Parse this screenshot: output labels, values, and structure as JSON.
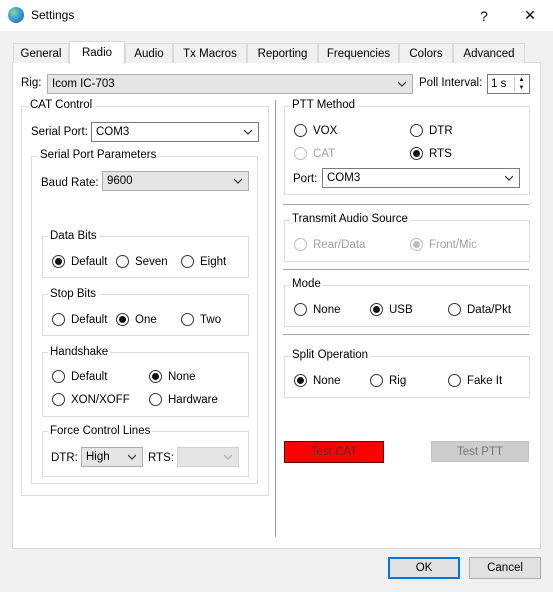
{
  "window": {
    "title": "Settings",
    "help_glyph": "?",
    "close_glyph": "✕"
  },
  "tabs": [
    "General",
    "Radio",
    "Audio",
    "Tx Macros",
    "Reporting",
    "Frequencies",
    "Colors",
    "Advanced"
  ],
  "active_tab": "Radio",
  "rig": {
    "label": "Rig:",
    "value": "Icom IC-703"
  },
  "poll": {
    "label": "Poll Interval:",
    "value": "1 s"
  },
  "cat": {
    "title": "CAT Control",
    "serial_port_label": "Serial Port:",
    "serial_port_value": "COM3",
    "params_title": "Serial Port Parameters",
    "baud_label": "Baud Rate:",
    "baud_value": "9600",
    "data_bits": {
      "title": "Data Bits",
      "options": [
        "Default",
        "Seven",
        "Eight"
      ],
      "selected": "Default"
    },
    "stop_bits": {
      "title": "Stop Bits",
      "options": [
        "Default",
        "One",
        "Two"
      ],
      "selected": "One"
    },
    "handshake": {
      "title": "Handshake",
      "options": [
        "Default",
        "None",
        "XON/XOFF",
        "Hardware"
      ],
      "selected": "None"
    },
    "force": {
      "title": "Force Control Lines",
      "dtr_label": "DTR:",
      "dtr_value": "High",
      "rts_label": "RTS:",
      "rts_value": ""
    }
  },
  "ptt": {
    "title": "PTT Method",
    "options": [
      "VOX",
      "DTR",
      "CAT",
      "RTS"
    ],
    "selected": "RTS",
    "disabled": [
      "CAT"
    ],
    "port_label": "Port:",
    "port_value": "COM3"
  },
  "tx_audio": {
    "title": "Transmit Audio Source",
    "options": [
      "Rear/Data",
      "Front/Mic"
    ],
    "selected": "Front/Mic"
  },
  "mode": {
    "title": "Mode",
    "options": [
      "None",
      "USB",
      "Data/Pkt"
    ],
    "selected": "USB"
  },
  "split": {
    "title": "Split Operation",
    "options": [
      "None",
      "Rig",
      "Fake It"
    ],
    "selected": "None"
  },
  "buttons": {
    "test_cat": "Test CAT",
    "test_ptt": "Test PTT",
    "ok": "OK",
    "cancel": "Cancel"
  },
  "colors": {
    "test_cat_bg": "#ff0000",
    "ok_border": "#0078d7"
  }
}
